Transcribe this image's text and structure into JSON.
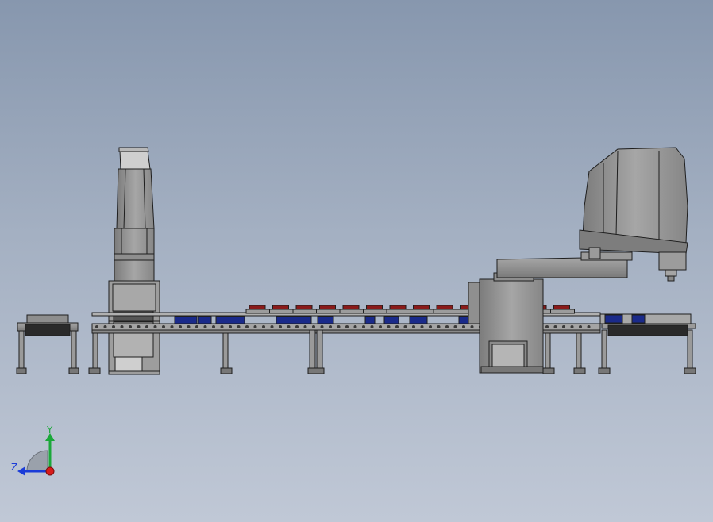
{
  "triad": {
    "x_label": "",
    "y_label": "Y",
    "z_label": "Z"
  },
  "colors": {
    "background_top": "#8797ae",
    "background_bottom": "#c0c8d6",
    "metal": "#9a9a9a",
    "metal_dark": "#6e6e6e",
    "outline": "#1e1e1e",
    "part_blue": "#1a2a8a",
    "part_red": "#8a1a1a",
    "belt": "#2a2a2a",
    "axis_x": "#d81b1b",
    "axis_y": "#1ba83a",
    "axis_z": "#1b3cd8"
  },
  "icons": {
    "triad": "coordinate-triad-icon"
  }
}
